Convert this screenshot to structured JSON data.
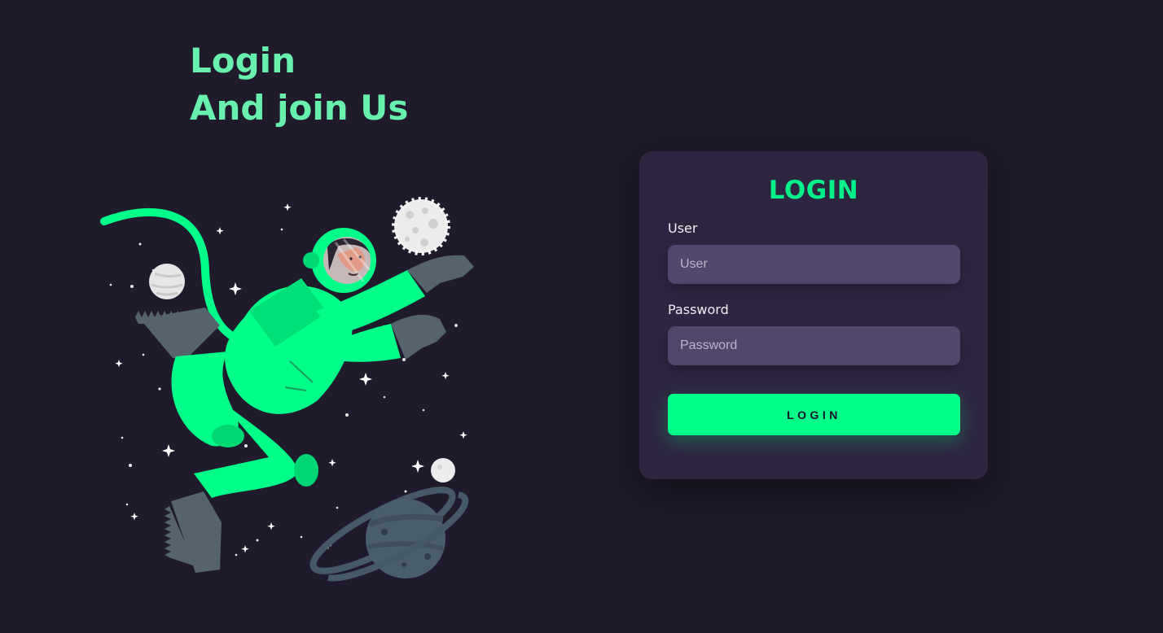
{
  "hero": {
    "line1": "Login",
    "line2": "And join Us"
  },
  "illustration": {
    "icon": "astronaut-icon"
  },
  "form": {
    "title": "LOGIN",
    "user_label": "User",
    "user_placeholder": "User",
    "user_value": "",
    "password_label": "Password",
    "password_placeholder": "Password",
    "password_value": "",
    "submit_label": "LOGIN"
  },
  "colors": {
    "background": "#1f1a2c",
    "accent": "#00ff88",
    "headline": "#67f1ad",
    "card": "#2e2640",
    "input": "#52466a"
  }
}
